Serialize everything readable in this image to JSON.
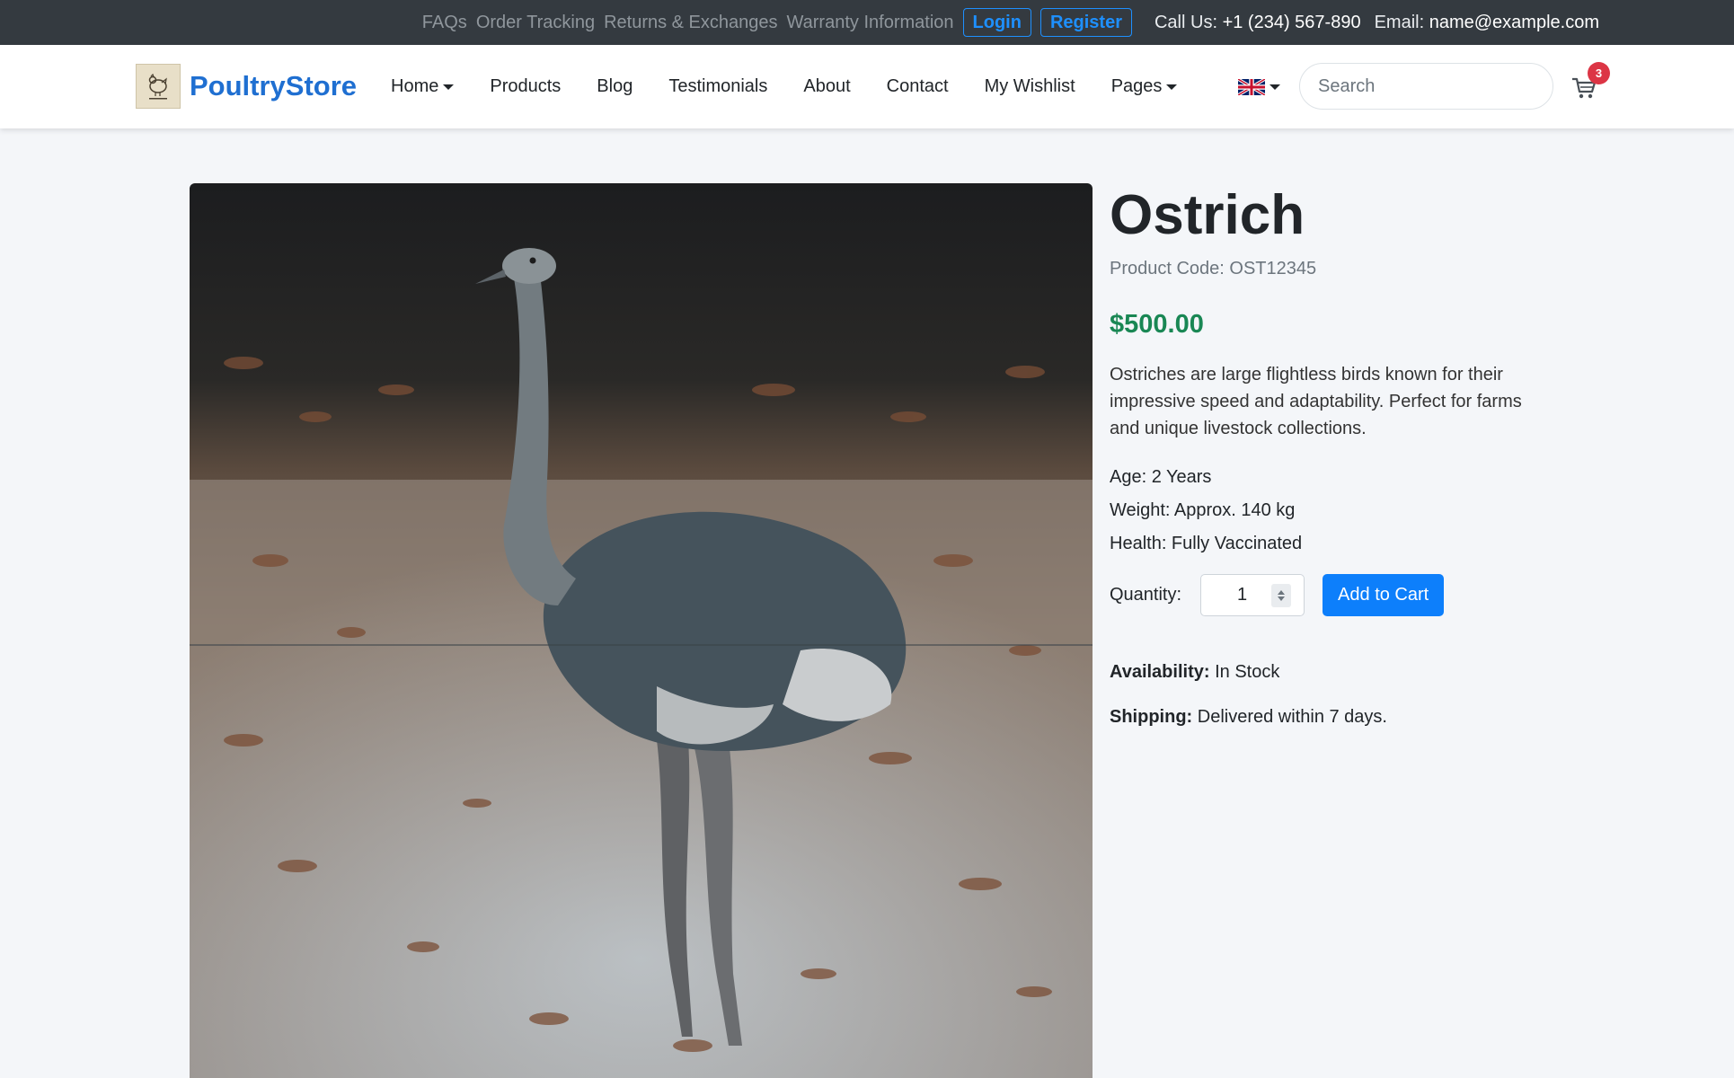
{
  "topbar": {
    "links": [
      "FAQs",
      "Order Tracking",
      "Returns & Exchanges",
      "Warranty Information"
    ],
    "login_label": "Login",
    "register_label": "Register",
    "call_label": "Call Us:",
    "call_value": "+1 (234) 567-890",
    "email_label": "Email:",
    "email_value": "name@example.com"
  },
  "navbar": {
    "brand": "PoultryStore",
    "items": [
      "Home",
      "Products",
      "Blog",
      "Testimonials",
      "About",
      "Contact",
      "My Wishlist",
      "Pages"
    ],
    "search_placeholder": "Search",
    "cart_count": "3",
    "language_icon": "uk-flag-icon"
  },
  "product": {
    "title": "Ostrich",
    "code": "Product Code: OST12345",
    "price": "$500.00",
    "description": "Ostriches are large flightless birds known for their impressive speed and adaptability. Perfect for farms and unique livestock collections.",
    "age": "Age: 2 Years",
    "weight": "Weight: Approx. 140 kg",
    "health": "Health: Fully Vaccinated",
    "quantity_label": "Quantity:",
    "quantity_value": "1",
    "add_to_cart_label": "Add to Cart",
    "availability_label": "Availability:",
    "availability_value": "In Stock",
    "shipping_label": "Shipping:",
    "shipping_value": "Delivered within 7 days."
  },
  "colors": {
    "topbar_bg": "#343a40",
    "brand": "#1f6fd1",
    "price": "#198754",
    "primary_button": "#0d7ffb",
    "badge": "#dc3545"
  }
}
